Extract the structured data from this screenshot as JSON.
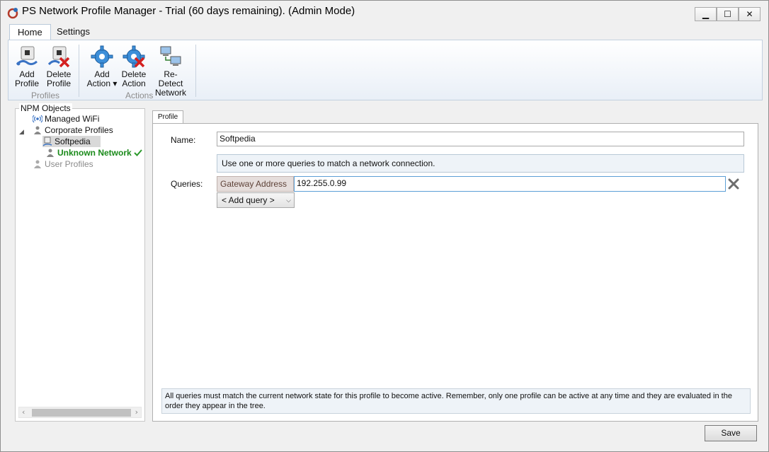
{
  "window": {
    "title": "PS Network Profile Manager - Trial (60 days remaining). (Admin Mode)",
    "minimize": "▁",
    "maximize": "☐",
    "close": "✕"
  },
  "ribbon": {
    "tabs": [
      {
        "label": "Home"
      },
      {
        "label": "Settings"
      }
    ],
    "groups": {
      "profiles": {
        "label": "Profiles",
        "add_profile": [
          "Add",
          "Profile"
        ],
        "delete_profile": [
          "Delete",
          "Profile"
        ]
      },
      "actions": {
        "label": "Actions",
        "add_action": [
          "Add",
          "Action ▾"
        ],
        "delete_action": [
          "Delete",
          "Action"
        ],
        "redetect_network": [
          "Re-Detect",
          "Network"
        ]
      }
    }
  },
  "tree": {
    "legend": "NPM Objects",
    "items": [
      {
        "label": "Managed WiFi"
      },
      {
        "label": "Corporate Profiles"
      },
      {
        "label": "Softpedia"
      },
      {
        "label": "Unknown Network"
      },
      {
        "label": "User Profiles"
      }
    ]
  },
  "profile": {
    "tab_label": "Profile",
    "name_label": "Name:",
    "name_value": "Softpedia",
    "info_text": "Use one or more queries to match a network connection.",
    "queries_label": "Queries:",
    "query_type": "Gateway Address",
    "query_value": "192.255.0.99",
    "add_query": "< Add query >",
    "note_line1": "All queries must match the current network state for this profile to become active. Remember, only one profile can be active at any time and they are evaluated in the",
    "note_line2": "order they appear in the tree."
  },
  "footer": {
    "save": "Save"
  },
  "colors": {
    "accent_green": "#1a8a1a",
    "ribbon_bg": "#e9eff7",
    "query_label_bg": "#e6dedc"
  }
}
